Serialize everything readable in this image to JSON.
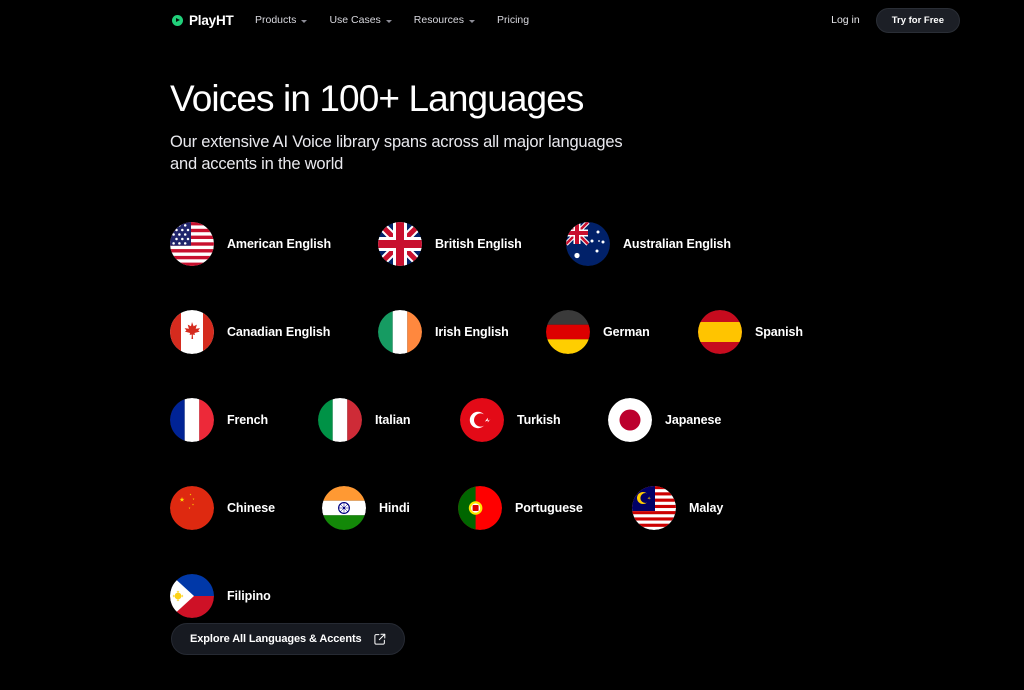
{
  "brand": {
    "name": "PlayHT",
    "mark_color": "#21d07a",
    "icon": "play-circle-icon"
  },
  "nav": {
    "links": [
      {
        "label": "Products",
        "has_dropdown": true
      },
      {
        "label": "Use Cases",
        "has_dropdown": true
      },
      {
        "label": "Resources",
        "has_dropdown": true
      },
      {
        "label": "Pricing",
        "has_dropdown": false
      }
    ],
    "login_label": "Log in",
    "cta_label": "Try for Free"
  },
  "hero": {
    "title": "Voices in 100+ Languages",
    "subtitle": "Our extensive AI Voice library spans across all major languages and accents in the world"
  },
  "languages": {
    "rows": [
      [
        {
          "label": "American English",
          "flag": "flag-us"
        },
        {
          "label": "British English",
          "flag": "flag-gb"
        },
        {
          "label": "Australian English",
          "flag": "flag-au"
        }
      ],
      [
        {
          "label": "Canadian English",
          "flag": "flag-ca"
        },
        {
          "label": "Irish English",
          "flag": "flag-ie"
        },
        {
          "label": "German",
          "flag": "flag-de"
        },
        {
          "label": "Spanish",
          "flag": "flag-es"
        }
      ],
      [
        {
          "label": "French",
          "flag": "flag-fr"
        },
        {
          "label": "Italian",
          "flag": "flag-it"
        },
        {
          "label": "Turkish",
          "flag": "flag-tr"
        },
        {
          "label": "Japanese",
          "flag": "flag-jp"
        }
      ],
      [
        {
          "label": "Chinese",
          "flag": "flag-cn"
        },
        {
          "label": "Hindi",
          "flag": "flag-in"
        },
        {
          "label": "Portuguese",
          "flag": "flag-pt"
        },
        {
          "label": "Malay",
          "flag": "flag-my"
        }
      ],
      [
        {
          "label": "Filipino",
          "flag": "flag-ph"
        }
      ]
    ]
  },
  "explore": {
    "label": "Explore All Languages & Accents",
    "icon": "external-link-icon"
  },
  "theme": {
    "background": "#000000",
    "text": "#ffffff",
    "accent": "#21d07a",
    "pill_bg": "#1c1f26"
  }
}
